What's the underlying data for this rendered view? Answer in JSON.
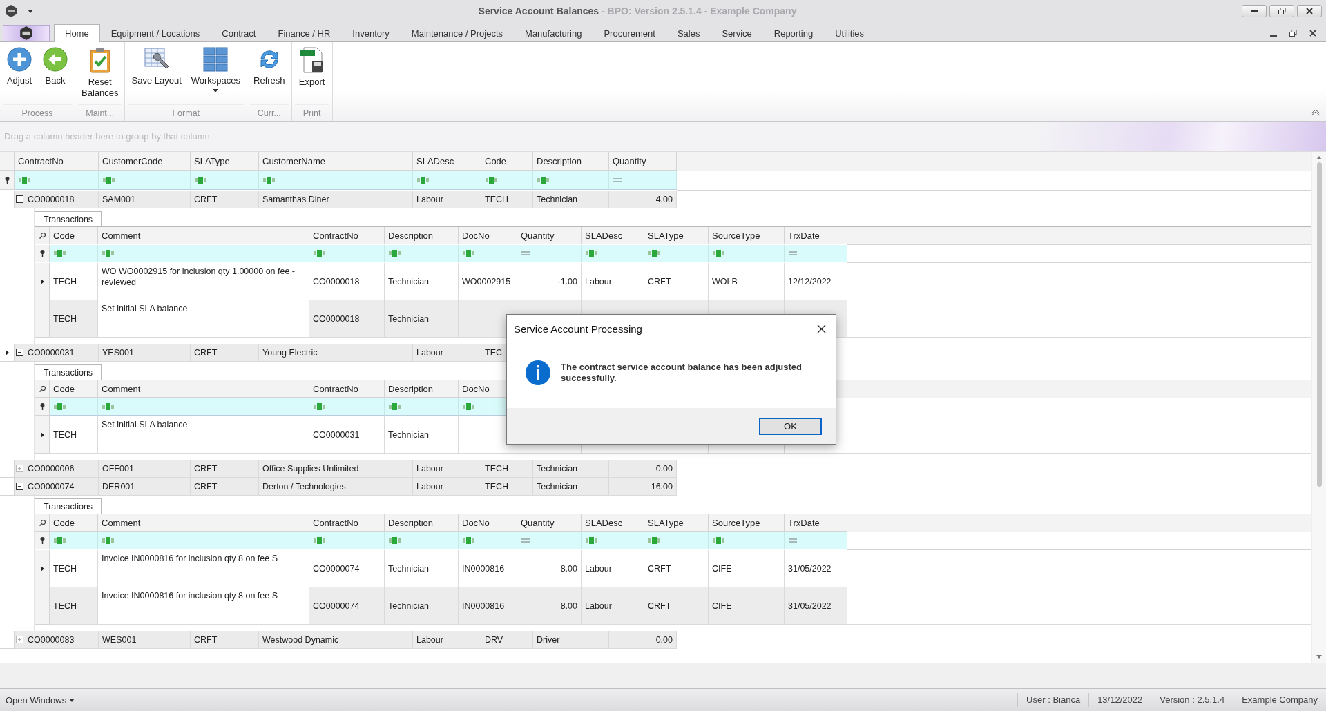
{
  "window": {
    "title": "Service Account Balances",
    "subtitle": " - BPO: Version 2.5.1.4 - Example Company"
  },
  "ribbon": {
    "tabs": [
      {
        "label": "Home",
        "selected": true
      },
      {
        "label": "Equipment / Locations",
        "selected": false
      },
      {
        "label": "Contract",
        "selected": false
      },
      {
        "label": "Finance / HR",
        "selected": false
      },
      {
        "label": "Inventory",
        "selected": false
      },
      {
        "label": "Maintenance / Projects",
        "selected": false
      },
      {
        "label": "Manufacturing",
        "selected": false
      },
      {
        "label": "Procurement",
        "selected": false
      },
      {
        "label": "Sales",
        "selected": false
      },
      {
        "label": "Service",
        "selected": false
      },
      {
        "label": "Reporting",
        "selected": false
      },
      {
        "label": "Utilities",
        "selected": false
      }
    ],
    "groups": [
      {
        "label": "Process",
        "buttons": [
          {
            "label": "Adjust",
            "kind": "add"
          },
          {
            "label": "Back",
            "kind": "back"
          }
        ]
      },
      {
        "label": "Maint...",
        "buttons": [
          {
            "label": "Reset\nBalances",
            "kind": "reset"
          }
        ]
      },
      {
        "label": "Format",
        "buttons": [
          {
            "label": "Save Layout",
            "kind": "layout"
          },
          {
            "label": "Workspaces",
            "kind": "workspaces",
            "dropdown": true
          }
        ]
      },
      {
        "label": "Curr...",
        "buttons": [
          {
            "label": "Refresh",
            "kind": "refresh"
          }
        ]
      },
      {
        "label": "Print",
        "buttons": [
          {
            "label": "Export",
            "kind": "export"
          }
        ]
      }
    ]
  },
  "group_panel": {
    "text": "Drag a column header here to group by that column"
  },
  "grid": {
    "columns": [
      {
        "label": "ContractNo",
        "kind": "text"
      },
      {
        "label": "CustomerCode",
        "kind": "text"
      },
      {
        "label": "SLAType",
        "kind": "text"
      },
      {
        "label": "CustomerName",
        "kind": "text"
      },
      {
        "label": "SLADesc",
        "kind": "text"
      },
      {
        "label": "Code",
        "kind": "text"
      },
      {
        "label": "Description",
        "kind": "text"
      },
      {
        "label": "Quantity",
        "kind": "number"
      }
    ],
    "groups": [
      {
        "expanded": true,
        "focused": false,
        "cells": [
          "CO0000018",
          "SAM001",
          "CRFT",
          "Samanthas Diner",
          "Labour",
          "TECH",
          "Technician",
          "4.00"
        ],
        "detail": {
          "tab": "Transactions",
          "columns": [
            {
              "label": "Code",
              "kind": "text"
            },
            {
              "label": "Comment",
              "kind": "text"
            },
            {
              "label": "ContractNo",
              "kind": "text"
            },
            {
              "label": "Description",
              "kind": "text"
            },
            {
              "label": "DocNo",
              "kind": "text"
            },
            {
              "label": "Quantity",
              "kind": "number"
            },
            {
              "label": "SLADesc",
              "kind": "text"
            },
            {
              "label": "SLAType",
              "kind": "text"
            },
            {
              "label": "SourceType",
              "kind": "text"
            },
            {
              "label": "TrxDate",
              "kind": "number"
            }
          ],
          "rows": [
            {
              "focused": true,
              "cells": [
                "TECH",
                "WO WO0002915 for inclusion qty 1.00000 on fee - reviewed",
                "CO0000018",
                "Technician",
                "WO0002915",
                "-1.00",
                "Labour",
                "CRFT",
                "WOLB",
                "12/12/2022"
              ]
            },
            {
              "focused": false,
              "cells": [
                "TECH",
                "Set initial SLA balance",
                "CO0000018",
                "Technician",
                null,
                null,
                null,
                null,
                null,
                null
              ]
            }
          ]
        }
      },
      {
        "expanded": true,
        "focused": true,
        "cells": [
          "CO0000031",
          "YES001",
          "CRFT",
          "Young Electric",
          "Labour",
          "TEC",
          null,
          null
        ],
        "detail": {
          "tab": "Transactions",
          "columns": [
            {
              "label": "Code",
              "kind": "text"
            },
            {
              "label": "Comment",
              "kind": "text"
            },
            {
              "label": "ContractNo",
              "kind": "text"
            },
            {
              "label": "Description",
              "kind": "text"
            },
            {
              "label": "DocNo",
              "kind": "text"
            },
            {},
            {},
            {},
            {},
            {}
          ],
          "rows": [
            {
              "focused": true,
              "cells": [
                "TECH",
                "Set initial SLA balance",
                "CO0000031",
                "Technician",
                null,
                null,
                null,
                null,
                null,
                null
              ]
            }
          ]
        }
      },
      {
        "expanded": false,
        "focused": false,
        "cells": [
          "CO0000006",
          "OFF001",
          "CRFT",
          "Office Supplies Unlimited",
          "Labour",
          "TECH",
          "Technician",
          "0.00"
        ]
      },
      {
        "expanded": true,
        "focused": false,
        "cells": [
          "CO0000074",
          "DER001",
          "CRFT",
          "Derton / Technologies",
          "Labour",
          "TECH",
          "Technician",
          "16.00"
        ],
        "detail": {
          "tab": "Transactions",
          "columns": [
            {
              "label": "Code",
              "kind": "text"
            },
            {
              "label": "Comment",
              "kind": "text"
            },
            {
              "label": "ContractNo",
              "kind": "text"
            },
            {
              "label": "Description",
              "kind": "text"
            },
            {
              "label": "DocNo",
              "kind": "text"
            },
            {
              "label": "Quantity",
              "kind": "number"
            },
            {
              "label": "SLADesc",
              "kind": "text"
            },
            {
              "label": "SLAType",
              "kind": "text"
            },
            {
              "label": "SourceType",
              "kind": "text"
            },
            {
              "label": "TrxDate",
              "kind": "number"
            }
          ],
          "rows": [
            {
              "focused": true,
              "cells": [
                "TECH",
                "Invoice IN0000816 for inclusion qty 8 on fee S",
                "CO0000074",
                "Technician",
                "IN0000816",
                "8.00",
                "Labour",
                "CRFT",
                "CIFE",
                "31/05/2022"
              ]
            },
            {
              "focused": false,
              "cells": [
                "TECH",
                "Invoice IN0000816 for inclusion qty 8 on fee S",
                "CO0000074",
                "Technician",
                "IN0000816",
                "8.00",
                "Labour",
                "CRFT",
                "CIFE",
                "31/05/2022"
              ]
            }
          ]
        }
      },
      {
        "expanded": false,
        "focused": false,
        "cells": [
          "CO0000083",
          "WES001",
          "CRFT",
          "Westwood Dynamic",
          "Labour",
          "DRV",
          "Driver",
          "0.00"
        ]
      }
    ]
  },
  "dialog": {
    "title": "Service Account Processing",
    "message": "The contract service account balance has been adjusted successfully.",
    "button": "OK"
  },
  "status_bar": {
    "menu": "Open Windows",
    "items": [
      "User : Bianca",
      "13/12/2022",
      "Version : 2.5.1.4",
      "Example Company"
    ]
  }
}
